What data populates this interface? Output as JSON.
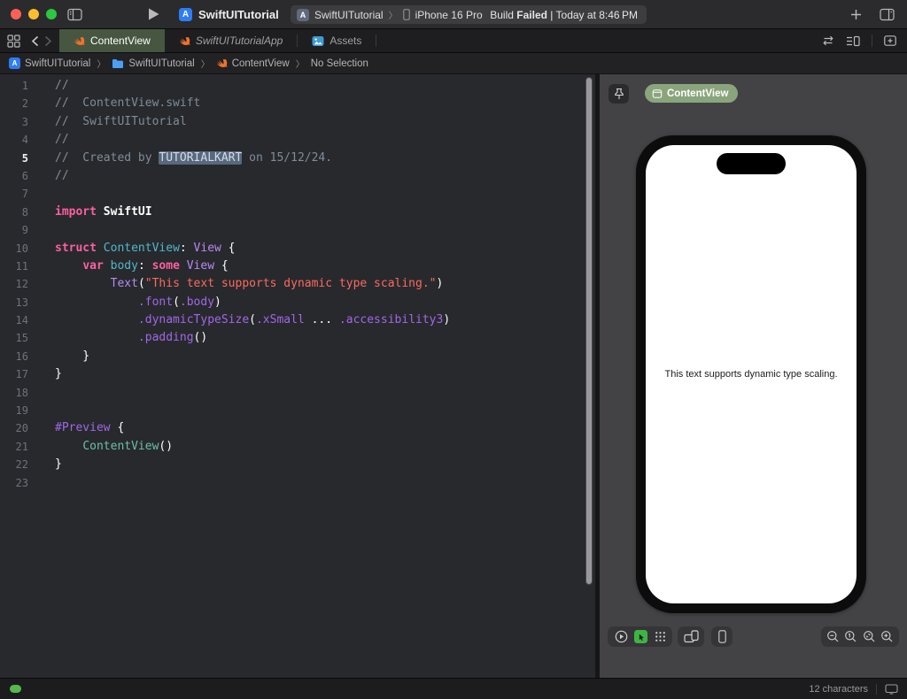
{
  "titlebar": {
    "project_title": "SwiftUITutorial",
    "scheme": {
      "target": "SwiftUITutorial",
      "chevron": "〉",
      "device": "iPhone 16 Pro"
    },
    "status": {
      "build": "Build ",
      "failed": "Failed",
      "time": " | Today at 8:46 PM"
    }
  },
  "tabs": [
    {
      "label": "ContentView",
      "active": true
    },
    {
      "label": "SwiftUITutorialApp",
      "active": false
    },
    {
      "label": "Assets",
      "active": false
    }
  ],
  "jumpbar": {
    "chevron": "〉",
    "items": [
      "SwiftUITutorial",
      "SwiftUITutorial",
      "ContentView",
      "No Selection"
    ]
  },
  "editor": {
    "current_line": 5,
    "lines": [
      {
        "n": 1,
        "segs": [
          [
            "//",
            "comment"
          ]
        ]
      },
      {
        "n": 2,
        "segs": [
          [
            "//  ContentView.swift",
            "comment"
          ]
        ]
      },
      {
        "n": 3,
        "segs": [
          [
            "//  SwiftUITutorial",
            "comment"
          ]
        ]
      },
      {
        "n": 4,
        "segs": [
          [
            "//",
            "comment"
          ]
        ]
      },
      {
        "n": 5,
        "segs": [
          [
            "//  Created by ",
            "comment"
          ],
          [
            "TUTORIALKART",
            "hl"
          ],
          [
            " on 15/12/24.",
            "comment"
          ]
        ]
      },
      {
        "n": 6,
        "segs": [
          [
            "//",
            "comment"
          ]
        ]
      },
      {
        "n": 7,
        "segs": []
      },
      {
        "n": 8,
        "segs": [
          [
            "import",
            "kw"
          ],
          [
            " ",
            "plain"
          ],
          [
            "SwiftUI",
            "bold"
          ]
        ]
      },
      {
        "n": 9,
        "segs": []
      },
      {
        "n": 10,
        "segs": [
          [
            "struct",
            "kw"
          ],
          [
            " ",
            "plain"
          ],
          [
            "ContentView",
            "decl"
          ],
          [
            ": ",
            "plain"
          ],
          [
            "View",
            "type"
          ],
          [
            " {",
            "plain"
          ]
        ]
      },
      {
        "n": 11,
        "segs": [
          [
            "    ",
            "plain"
          ],
          [
            "var",
            "kw"
          ],
          [
            " ",
            "plain"
          ],
          [
            "body",
            "decl"
          ],
          [
            ": ",
            "plain"
          ],
          [
            "some",
            "kw"
          ],
          [
            " ",
            "plain"
          ],
          [
            "View",
            "type"
          ],
          [
            " {",
            "plain"
          ]
        ]
      },
      {
        "n": 12,
        "segs": [
          [
            "        ",
            "plain"
          ],
          [
            "Text",
            "type"
          ],
          [
            "(",
            "plain"
          ],
          [
            "\"This text supports dynamic type scaling.\"",
            "str"
          ],
          [
            ")",
            "plain"
          ]
        ]
      },
      {
        "n": 13,
        "segs": [
          [
            "            ",
            "plain"
          ],
          [
            ".font",
            "member"
          ],
          [
            "(",
            "plain"
          ],
          [
            ".body",
            "member"
          ],
          [
            ")",
            "plain"
          ]
        ]
      },
      {
        "n": 14,
        "segs": [
          [
            "            ",
            "plain"
          ],
          [
            ".dynamicTypeSize",
            "member"
          ],
          [
            "(",
            "plain"
          ],
          [
            ".xSmall",
            "member"
          ],
          [
            " ... ",
            "plain"
          ],
          [
            ".accessibility3",
            "member"
          ],
          [
            ")",
            "plain"
          ]
        ]
      },
      {
        "n": 15,
        "segs": [
          [
            "            ",
            "plain"
          ],
          [
            ".padding",
            "member"
          ],
          [
            "()",
            "plain"
          ]
        ]
      },
      {
        "n": 16,
        "segs": [
          [
            "    }",
            "plain"
          ]
        ]
      },
      {
        "n": 17,
        "segs": [
          [
            "}",
            "plain"
          ]
        ]
      },
      {
        "n": 18,
        "segs": []
      },
      {
        "n": 19,
        "segs": []
      },
      {
        "n": 20,
        "segs": [
          [
            "#Preview",
            "member"
          ],
          [
            " {",
            "plain"
          ]
        ]
      },
      {
        "n": 21,
        "segs": [
          [
            "    ",
            "plain"
          ],
          [
            "ContentView",
            "mint"
          ],
          [
            "()",
            "plain"
          ]
        ]
      },
      {
        "n": 22,
        "segs": [
          [
            "}",
            "plain"
          ]
        ]
      },
      {
        "n": 23,
        "segs": []
      }
    ]
  },
  "canvas": {
    "preview_pill_label": "ContentView",
    "device_screen_text": "This text supports dynamic type scaling."
  },
  "statusbar": {
    "right_text": "12 characters"
  },
  "icons": [
    "sidebar-toggle-icon",
    "run-play-icon",
    "app-icon",
    "device-icon",
    "plus-icon",
    "inspector-toggle-icon",
    "related-items-icon",
    "chevron-back-icon",
    "chevron-forward-icon",
    "swift-icon",
    "assets-icon",
    "folder-icon",
    "swap-icon",
    "editor-options-icon",
    "add-editor-icon",
    "pin-icon",
    "app-window-icon",
    "play-circle-icon",
    "select-mode-icon",
    "variants-grid-icon",
    "orientation-icon",
    "phone-icon",
    "zoom-out-icon",
    "zoom-100-icon",
    "zoom-fit-icon",
    "zoom-in-icon",
    "display-icon",
    "ready-indicator"
  ],
  "colors": {
    "kw": "#FC5FA3",
    "string": "#FC6A5D",
    "type": "#B78AF2",
    "member": "#A167E6",
    "decl": "#4FB8CC",
    "mint": "#66C2A3",
    "comment": "#7F8C98",
    "selection": "#56697F",
    "tab_active": "#475640",
    "pill_green": "#8AA57C",
    "swift_orange": "#F0722C",
    "app_blue": "#2E7CF6",
    "mode_green": "#3FB445",
    "indicator_green": "#57B84B"
  }
}
